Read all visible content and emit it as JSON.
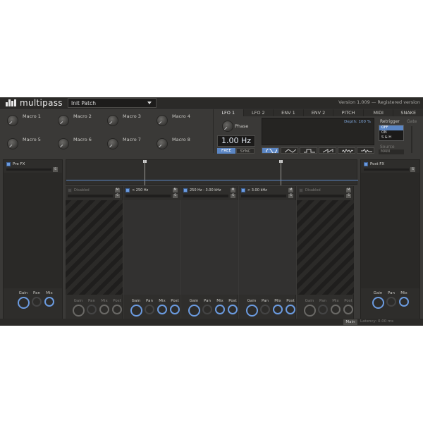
{
  "header": {
    "logo_text": "multipass",
    "preset": "Init Patch",
    "version": "Version 1.009 — Registered version"
  },
  "macros": [
    "Macro 1",
    "Macro 2",
    "Macro 3",
    "Macro 4",
    "Macro 5",
    "Macro 6",
    "Macro 7",
    "Macro 8"
  ],
  "modulation": {
    "tabs": [
      "LFO 1",
      "LFO 2",
      "ENV 1",
      "ENV 2",
      "PITCH",
      "MIDI",
      "SNAKE"
    ],
    "active_tab": "LFO 1",
    "phase_label": "Phase",
    "rate": "1.00 Hz",
    "free_label": "FREE",
    "sync_label": "SYNC",
    "depth": "Depth: 100 %",
    "retrigger_label": "Retrigger",
    "retrigger_options": [
      "OFF",
      "ON",
      "S & H"
    ],
    "retrigger_selected": "OFF",
    "gate_label": "Gate",
    "source_label": "Source",
    "source_value": "MAIN"
  },
  "pre_fx": {
    "label": "Pre FX",
    "s": "S"
  },
  "post_fx": {
    "label": "Post FX",
    "s": "S"
  },
  "bands": [
    {
      "label": "Disabled",
      "enabled": false,
      "m": "M",
      "s": "S"
    },
    {
      "label": "< 250 Hz",
      "enabled": true,
      "m": "M",
      "s": "S"
    },
    {
      "label": "250 Hz - 3.00 kHz",
      "enabled": true,
      "m": "M",
      "s": "S"
    },
    {
      "label": "> 3.00 kHz",
      "enabled": true,
      "m": "M",
      "s": "S"
    },
    {
      "label": "Disabled",
      "enabled": false,
      "m": "M",
      "s": "S"
    }
  ],
  "knob_labels": {
    "gain": "Gain",
    "pan": "Pan",
    "mix": "Mix",
    "post": "Post"
  },
  "status": {
    "main": "Main",
    "latency": "Latency: 0.00 ms"
  },
  "colors": {
    "accent": "#6b9be0",
    "background": "#3a3937"
  }
}
